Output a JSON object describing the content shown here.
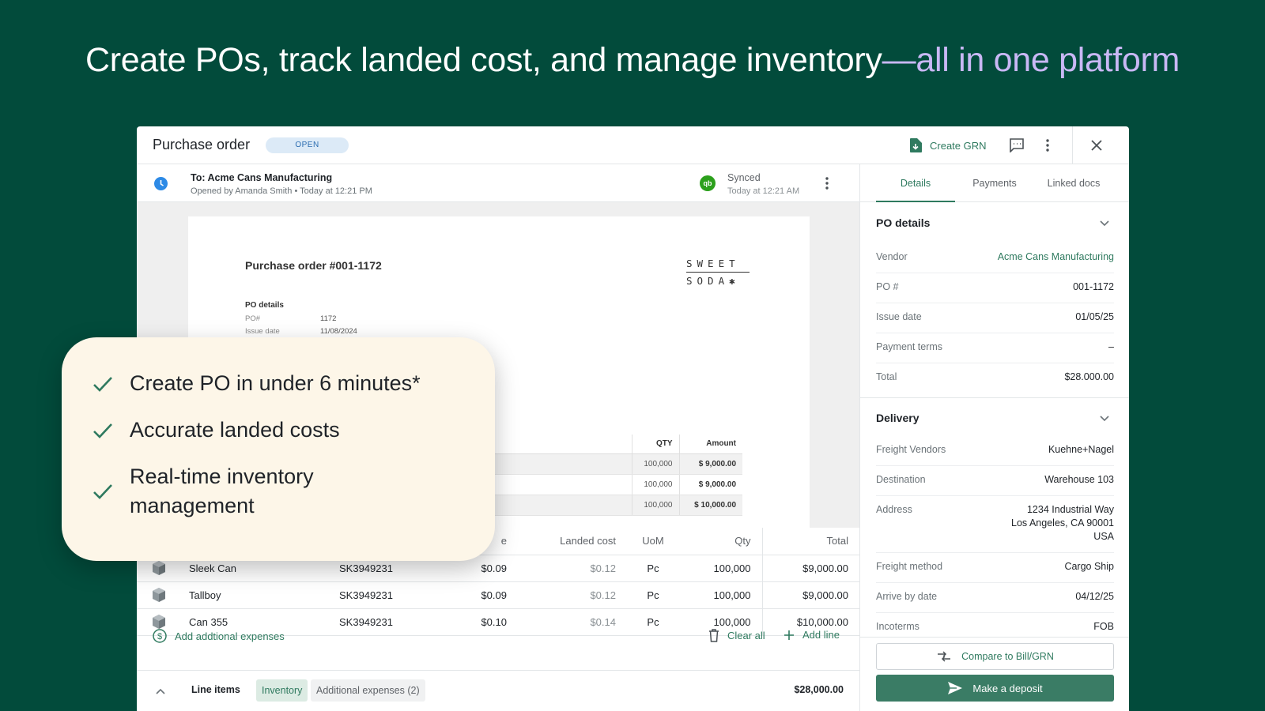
{
  "headline": {
    "main": "Create POs, track landed cost, and manage inventory",
    "accent": "—all in one platform"
  },
  "topbar": {
    "title": "Purchase order",
    "status_badge": "OPEN",
    "create_grn": "Create GRN"
  },
  "subbar": {
    "to": "To: Acme Cans Manufacturing",
    "opened": "Opened by Amanda Smith • Today at 12:21 PM",
    "qb_badge": "qb",
    "synced": "Synced",
    "synced_time": "Today at 12:21 AM"
  },
  "document": {
    "title": "Purchase order  #001-1172",
    "logo": {
      "line1": "SWEET",
      "line2": "SODA✱"
    },
    "po_details_label": "PO details",
    "fields": [
      {
        "label": "PO#",
        "value": "1172"
      },
      {
        "label": "Issue date",
        "value": "11/08/2024"
      }
    ],
    "table": {
      "headers": {
        "qty": "QTY",
        "amount": "Amount"
      },
      "rows": [
        {
          "qty": "100,000",
          "amount": "$ 9,000.00"
        },
        {
          "qty": "100,000",
          "amount": "$ 9,000.00"
        },
        {
          "qty": "100,000",
          "amount": "$ 10,000.00"
        }
      ]
    }
  },
  "line_items": {
    "headers": {
      "price": "e",
      "landed": "Landed cost",
      "uom": "UoM",
      "qty": "Qty",
      "total": "Total"
    },
    "rows": [
      {
        "name": "Sleek Can",
        "sku": "SK3949231",
        "price": "$0.09",
        "landed": "$0.12",
        "uom": "Pc",
        "qty": "100,000",
        "total": "$9,000.00"
      },
      {
        "name": "Tallboy",
        "sku": "SK3949231",
        "price": "$0.09",
        "landed": "$0.12",
        "uom": "Pc",
        "qty": "100,000",
        "total": "$9,000.00"
      },
      {
        "name": "Can 355",
        "sku": "SK3949231",
        "price": "$0.10",
        "landed": "$0.14",
        "uom": "Pc",
        "qty": "100,000",
        "total": "$10,000.00"
      }
    ],
    "add_expenses": "Add addtional expenses",
    "clear_all": "Clear all",
    "add_line": "Add line"
  },
  "footer": {
    "label": "Line items",
    "tab_inventory": "Inventory",
    "tab_expenses": "Additional expenses (2)",
    "total": "$28,000.00"
  },
  "sidebar": {
    "tabs": [
      "Details",
      "Payments",
      "Linked docs"
    ],
    "po_details": {
      "title": "PO details",
      "rows": [
        {
          "label": "Vendor",
          "value": "Acme Cans Manufacturing"
        },
        {
          "label": "PO #",
          "value": "001-1172"
        },
        {
          "label": "Issue date",
          "value": "01/05/25"
        },
        {
          "label": "Payment terms",
          "value": "–"
        },
        {
          "label": "Total",
          "value": "$28.000.00"
        }
      ]
    },
    "delivery": {
      "title": "Delivery",
      "rows": [
        {
          "label": "Freight Vendors",
          "value": "Kuehne+Nagel"
        },
        {
          "label": "Destination",
          "value": "Warehouse 103"
        },
        {
          "label": "Address",
          "line1": "1234 Industrial Way",
          "line2": "Los Angeles, CA 90001",
          "line3": "USA"
        },
        {
          "label": "Freight method",
          "value": "Cargo Ship"
        },
        {
          "label": "Arrive by date",
          "value": "04/12/25"
        },
        {
          "label": "Incoterms",
          "value": "FOB"
        }
      ]
    },
    "compare_button": "Compare to Bill/GRN",
    "deposit_button": "Make a deposit"
  },
  "callout": {
    "items": [
      "Create PO in under 6 minutes*",
      "Accurate landed costs",
      "Real-time inventory management"
    ]
  },
  "colors": {
    "background": "#024b3b",
    "accent_green": "#2f7a5f",
    "headline_accent": "#c9b8f5",
    "callout_bg": "#fdf6e8"
  }
}
